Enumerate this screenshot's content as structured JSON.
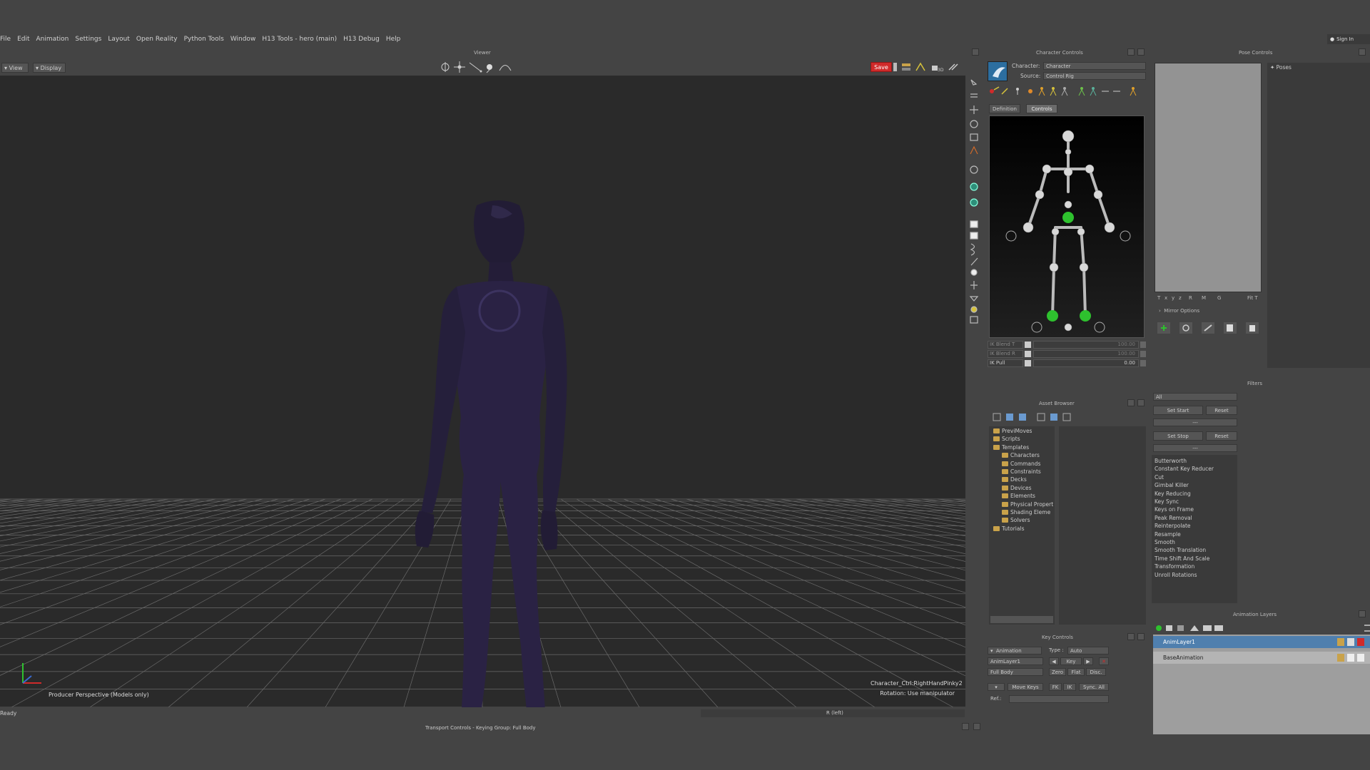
{
  "menu": [
    "File",
    "Edit",
    "Animation",
    "Settings",
    "Layout",
    "Open Reality",
    "Python Tools",
    "Window",
    "H13 Tools - hero (main)",
    "H13 Debug",
    "Help"
  ],
  "signin": "Sign In",
  "viewer": {
    "title": "Viewer",
    "view_btn": "View",
    "display_btn": "Display",
    "save_btn": "Save",
    "camera_label": "Producer Perspective (Models only)",
    "info_line1": "Character_Ctrl:RightHandPinky2",
    "info_line2": "Rotation: Use manipulator"
  },
  "character_controls": {
    "title": "Character Controls",
    "character_label": "Character:",
    "character_value": "Character",
    "source_label": "Source:",
    "source_value": "Control Rig",
    "tab_definition": "Definition",
    "tab_controls": "Controls",
    "ik_rows": [
      {
        "label": "IK Blend T",
        "value": "100.00"
      },
      {
        "label": "IK Blend R",
        "value": "100.00"
      },
      {
        "label": "IK Pull",
        "value": "0.00"
      }
    ]
  },
  "pose_controls": {
    "title": "Pose Controls",
    "poses_label": "Poses",
    "axis_labels": [
      "T",
      "x",
      "y",
      "z",
      "R",
      "M",
      "G",
      "Fit T"
    ],
    "mirror_options": "Mirror Options"
  },
  "asset_browser": {
    "title": "Asset Browser",
    "tree": [
      {
        "label": "PreviMoves",
        "level": 0
      },
      {
        "label": "Scripts",
        "level": 0
      },
      {
        "label": "Templates",
        "level": 0
      },
      {
        "label": "Characters",
        "level": 1
      },
      {
        "label": "Commands",
        "level": 1
      },
      {
        "label": "Constraints",
        "level": 1
      },
      {
        "label": "Decks",
        "level": 1
      },
      {
        "label": "Devices",
        "level": 1
      },
      {
        "label": "Elements",
        "level": 1
      },
      {
        "label": "Physical Propert",
        "level": 1
      },
      {
        "label": "Shading Eleme",
        "level": 1
      },
      {
        "label": "Solvers",
        "level": 1
      },
      {
        "label": "Tutorials",
        "level": 0
      }
    ]
  },
  "filters": {
    "title": "Filters",
    "dropdown_value": "All",
    "set_start": "Set Start",
    "reset": "Reset",
    "set_stop": "Set Stop",
    "placeholder_dash": "---",
    "list": [
      "Butterworth",
      "Constant Key Reducer",
      "Cut",
      "Gimbal Killer",
      "Key Reducing",
      "Key Sync",
      "Keys on Frame",
      "Peak Removal",
      "Reinterpolate",
      "Resample",
      "Smooth",
      "Smooth Translation",
      "Time Shift And Scale",
      "Transformation",
      "Unroll Rotations"
    ]
  },
  "key_controls": {
    "title": "Key Controls",
    "animation": "Animation",
    "type_label": "Type :",
    "type_value": "Auto",
    "layer_value": "AnimLayer1",
    "key_btn": "Key",
    "body_value": "Full Body",
    "zero_btn": "Zero",
    "flat_btn": "Flat",
    "disc_btn": "Disc.",
    "move_keys_btn": "Move Keys",
    "fk_btn": "FK",
    "ik_btn": "IK",
    "sync_btn": "Sync. All",
    "ref_label": "Ref.:"
  },
  "animation_layers": {
    "title": "Animation Layers",
    "layers": [
      "AnimLayer1",
      "BaseAnimation"
    ]
  },
  "status": {
    "ready": "Ready",
    "transport": "Transport Controls  -  Keying Group: Full Body",
    "rlabel": "R (left)"
  },
  "colors": {
    "accent_red": "#d02a2a",
    "selected_layer": "#4f7fae",
    "effector_green": "#2ec12e"
  }
}
